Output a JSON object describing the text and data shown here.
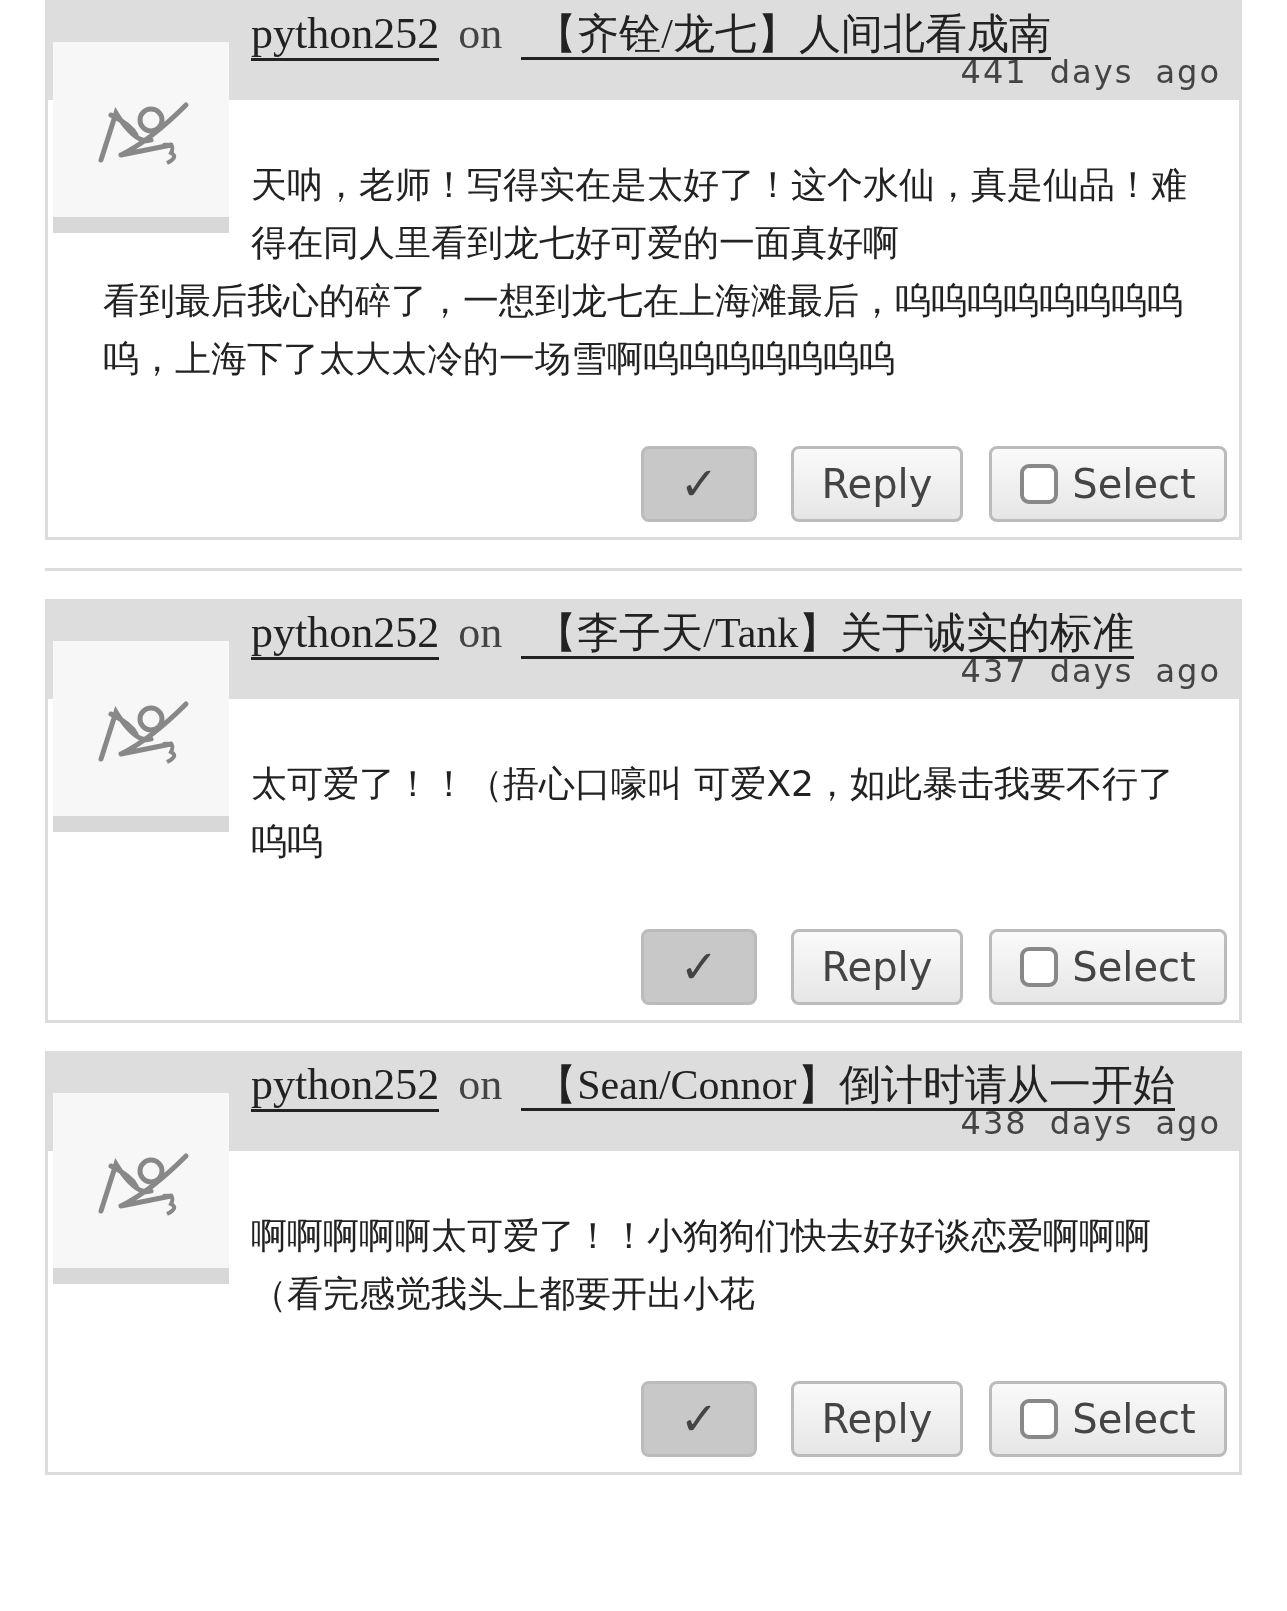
{
  "comments": [
    {
      "user": "python252",
      "connector": "on",
      "work": "【齐铨/龙七】人间北看成南",
      "age": "441 days ago",
      "paragraphs": [
        "天呐，老师！写得实在是太好了！这个水仙，真是仙品！难得在同人里看到龙七好可爱的一面真好啊",
        "看到最后我心的碎了，一想到龙七在上海滩最后，呜呜呜呜呜呜呜呜呜，上海下了太大太冷的一场雪啊呜呜呜呜呜呜呜"
      ],
      "approve": {
        "label": "✓",
        "pressed": true
      },
      "reply": "Reply",
      "select": {
        "label": "Select",
        "selected": false
      }
    },
    {
      "user": "python252",
      "connector": "on",
      "work": "【李子天/Tank】关于诚实的标准",
      "age": "437 days ago",
      "paragraphs": [
        "太可爱了！！（捂心口嚎叫 可爱X2，如此暴击我要不行了呜呜"
      ],
      "approve": {
        "label": "✓",
        "pressed": true
      },
      "reply": "Reply",
      "select": {
        "label": "Select",
        "selected": false
      }
    },
    {
      "user": "python252",
      "connector": "on",
      "work": "【Sean/Connor】倒计时请从一开始",
      "age": "438 days ago",
      "paragraphs": [
        "啊啊啊啊啊太可爱了！！小狗狗们快去好好谈恋爱啊啊啊（看完感觉我头上都要开出小花"
      ],
      "approve": {
        "label": "✓",
        "pressed": true
      },
      "reply": "Reply",
      "select": {
        "label": "Select",
        "selected": false
      }
    }
  ]
}
